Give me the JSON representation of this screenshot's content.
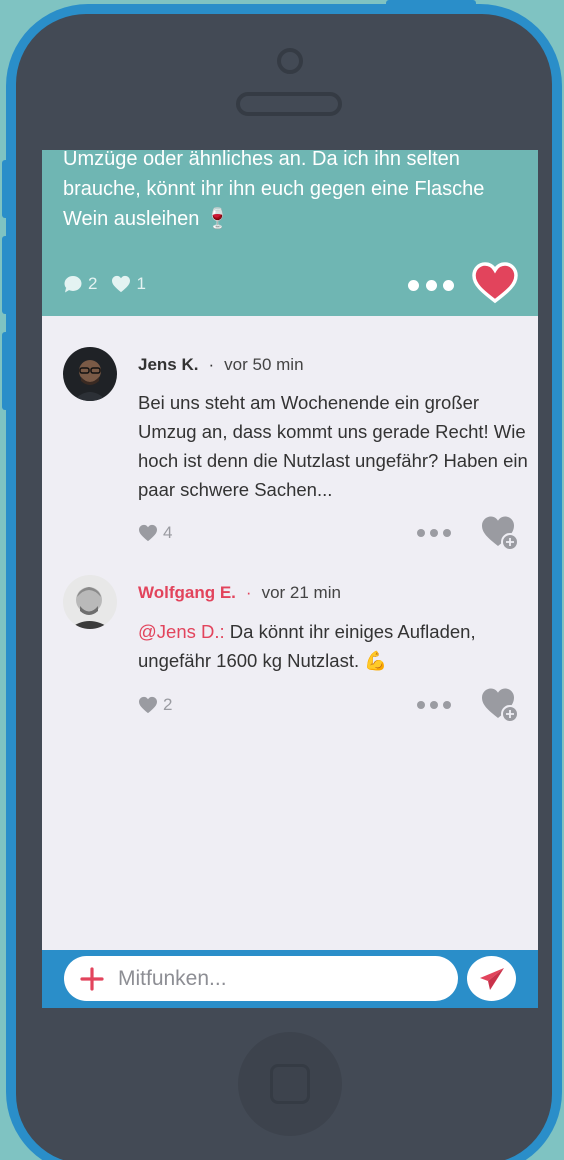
{
  "post": {
    "text_line1": "Umzüge oder ähnliches an. Da ich ihn selten",
    "text_line2": "brauche, könnt ihr ihn euch gegen eine Flasche",
    "text_line3": "Wein ausleihen 🍷",
    "comment_count": "2",
    "like_count": "1"
  },
  "comments": [
    {
      "author": "Jens K.",
      "separator": "·",
      "time": "vor 50 min",
      "text": "Bei uns steht am Wochenende ein großer Umzug an, dass kommt uns gerade Recht! Wie hoch ist denn die Nutzlast ungefähr? Haben ein paar schwere Sachen...",
      "likes": "4"
    },
    {
      "author": "Wolfgang E.",
      "separator": "·",
      "time": "vor 21 min",
      "mention": "@Jens D.:",
      "text": " Da könnt ihr einiges Aufladen, ungefähr 1600 kg Nutzlast. 💪",
      "likes": "2"
    }
  ],
  "composer": {
    "placeholder": "Mitfunken..."
  },
  "colors": {
    "background": "#7fc3c2",
    "frame": "#2a8ec9",
    "phone_body": "#434a55",
    "post_bg": "#6fb6b3",
    "accent_red": "#e2445c",
    "screen_bg": "#efeef4"
  },
  "icons": [
    "comment-icon",
    "heart-icon",
    "more-dots-icon",
    "heart-filled-icon",
    "heart-add-icon",
    "plus-icon",
    "send-plane-icon",
    "home-button-icon"
  ]
}
